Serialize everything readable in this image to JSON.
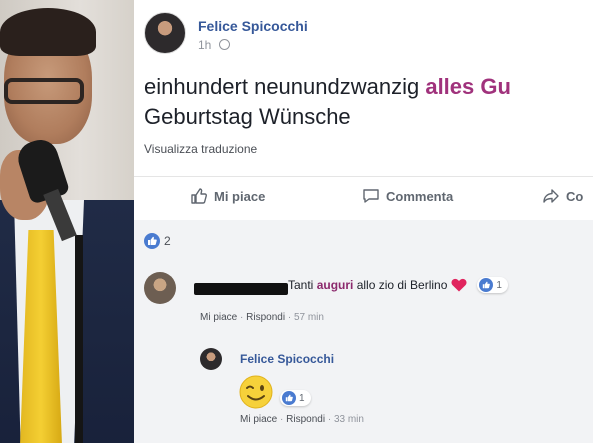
{
  "post": {
    "author": "Felice Spicocchi",
    "time": "1h",
    "text_line1_plain": "einhundert neunundzwanzig ",
    "text_line1_highlight": "alles Gu",
    "text_line2": "Geburtstag Wünsche",
    "see_translation": "Visualizza traduzione"
  },
  "actions": {
    "like": "Mi piace",
    "comment": "Commenta",
    "share": "Co"
  },
  "reactions": {
    "likes_count": "2"
  },
  "comment": {
    "text_pre": "Tanti ",
    "text_highlight": "auguri",
    "text_post": " allo zio di Berlino",
    "reaction_count": "1",
    "like_link": "Mi piace",
    "reply_link": "Rispondi",
    "time": "57 min"
  },
  "reply": {
    "author": "Felice Spicocchi",
    "reaction_count": "1",
    "like_link": "Mi piace",
    "reply_link": "Rispondi",
    "time": "33 min"
  },
  "icons": {
    "globe": "globe-icon",
    "like": "thumbs-up-icon",
    "comment": "comment-bubble-icon",
    "share": "share-arrow-icon",
    "heart": "heart-icon",
    "wink": "wink-emoji-icon"
  },
  "colors": {
    "link_blue": "#365899",
    "highlight": "#a0327c",
    "like_blue": "#4a7bd0",
    "heart_red": "#e0245e"
  }
}
